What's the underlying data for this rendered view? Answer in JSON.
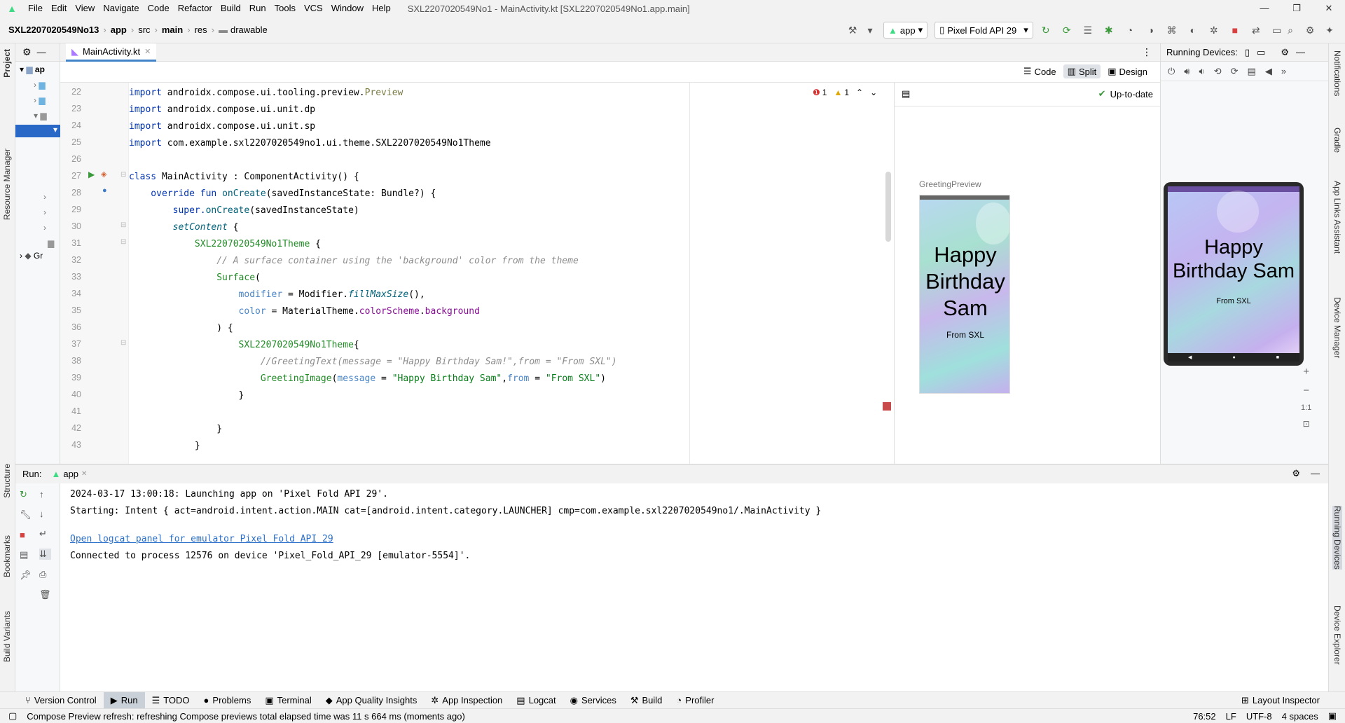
{
  "menubar": {
    "items": [
      "File",
      "Edit",
      "View",
      "Navigate",
      "Code",
      "Refactor",
      "Build",
      "Run",
      "Tools",
      "VCS",
      "Window",
      "Help"
    ],
    "window_title": "SXL2207020549No1 - MainActivity.kt [SXL2207020549No1.app.main]"
  },
  "breadcrumb": [
    "SXL2207020549No13",
    "app",
    "src",
    "main",
    "res",
    "drawable"
  ],
  "toolbar": {
    "run_config": "app",
    "device": "Pixel Fold API 29"
  },
  "editor": {
    "tab_label": "MainActivity.kt",
    "view_modes": [
      "Code",
      "Split",
      "Design"
    ],
    "errors": "1",
    "warnings": "1",
    "line_numbers": [
      "22",
      "23",
      "24",
      "25",
      "26",
      "27",
      "28",
      "29",
      "30",
      "31",
      "32",
      "33",
      "34",
      "35",
      "36",
      "37",
      "38",
      "39",
      "40",
      "41",
      "42",
      "43"
    ]
  },
  "code": {
    "l22a": "import ",
    "l22b": "androidx.compose.ui.tooling.preview.",
    "l22c": "Preview",
    "l23a": "import ",
    "l23b": "androidx.compose.ui.unit.dp",
    "l24a": "import ",
    "l24b": "androidx.compose.ui.unit.sp",
    "l25a": "import ",
    "l25b": "com.example.sxl2207020549no1.ui.theme.SXL2207020549No1Theme",
    "l27a": "class ",
    "l27b": "MainActivity : ComponentActivity() {",
    "l28a": "    override fun ",
    "l28b": "onCreate",
    "l28c": "(savedInstanceState: Bundle?) {",
    "l29a": "        super.",
    "l29b": "onCreate",
    "l29c": "(savedInstanceState)",
    "l30a": "        ",
    "l30b": "setContent",
    "l30c": " {",
    "l31a": "            ",
    "l31b": "SXL2207020549No1Theme",
    "l31c": " {",
    "l32": "                // A surface container using the 'background' color from the theme",
    "l33a": "                ",
    "l33b": "Surface",
    "l33c": "(",
    "l34a": "                    ",
    "l34b": "modifier",
    "l34c": " = Modifier.",
    "l34d": "fillMaxSize",
    "l34e": "(),",
    "l35a": "                    ",
    "l35b": "color",
    "l35c": " = MaterialTheme.",
    "l35d": "colorScheme",
    "l35e": ".",
    "l35f": "background",
    "l36": "                ) {",
    "l37a": "                    ",
    "l37b": "SXL2207020549No1Theme",
    "l37c": "{",
    "l38": "                        //GreetingText(message = \"Happy Birthday Sam!\",from = \"From SXL\")",
    "l39a": "                        ",
    "l39b": "GreetingImage",
    "l39c": "(",
    "l39d": "message",
    "l39e": " = ",
    "l39f": "\"Happy Birthday Sam\"",
    "l39g": ",",
    "l39h": "from",
    "l39i": " = ",
    "l39j": "\"From SXL\"",
    "l39k": ")",
    "l40": "                    }",
    "l42": "                }",
    "l43": "            }"
  },
  "design": {
    "status": "Up-to-date",
    "preview_label": "GreetingPreview",
    "greeting": "Happy Birthday Sam",
    "from": "From SXL"
  },
  "running_devices": {
    "title": "Running Devices:",
    "greeting": "Happy Birthday Sam",
    "from": "From SXL",
    "zoom_ratio": "1:1"
  },
  "run_panel": {
    "label": "Run:",
    "tab": "app",
    "lines": [
      "2024-03-17 13:00:18: Launching app on 'Pixel Fold API 29'.",
      "Starting: Intent { act=android.intent.action.MAIN cat=[android.intent.category.LAUNCHER] cmp=com.example.sxl2207020549no1/.MainActivity }",
      "Open logcat panel for emulator Pixel Fold API 29",
      "Connected to process 12576 on device 'Pixel_Fold_API_29 [emulator-5554]'."
    ]
  },
  "bottom_tabs": [
    "Version Control",
    "Run",
    "TODO",
    "Problems",
    "Terminal",
    "App Quality Insights",
    "App Inspection",
    "Logcat",
    "Services",
    "Build",
    "Profiler",
    "Layout Inspector"
  ],
  "left_tabs": [
    "Project",
    "Resource Manager",
    "Structure",
    "Bookmarks",
    "Build Variants"
  ],
  "right_tabs": [
    "Notifications",
    "Gradle",
    "App Links Assistant",
    "Device Manager",
    "Running Devices",
    "Device Explorer"
  ],
  "project_tree": {
    "gradle_partial": "Gr"
  },
  "statusbar": {
    "message": "Compose Preview refresh: refreshing Compose previews total elapsed time was 11 s 664 ms (moments ago)",
    "position": "76:52",
    "line_sep": "LF",
    "encoding": "UTF-8",
    "indent": "4 spaces"
  }
}
